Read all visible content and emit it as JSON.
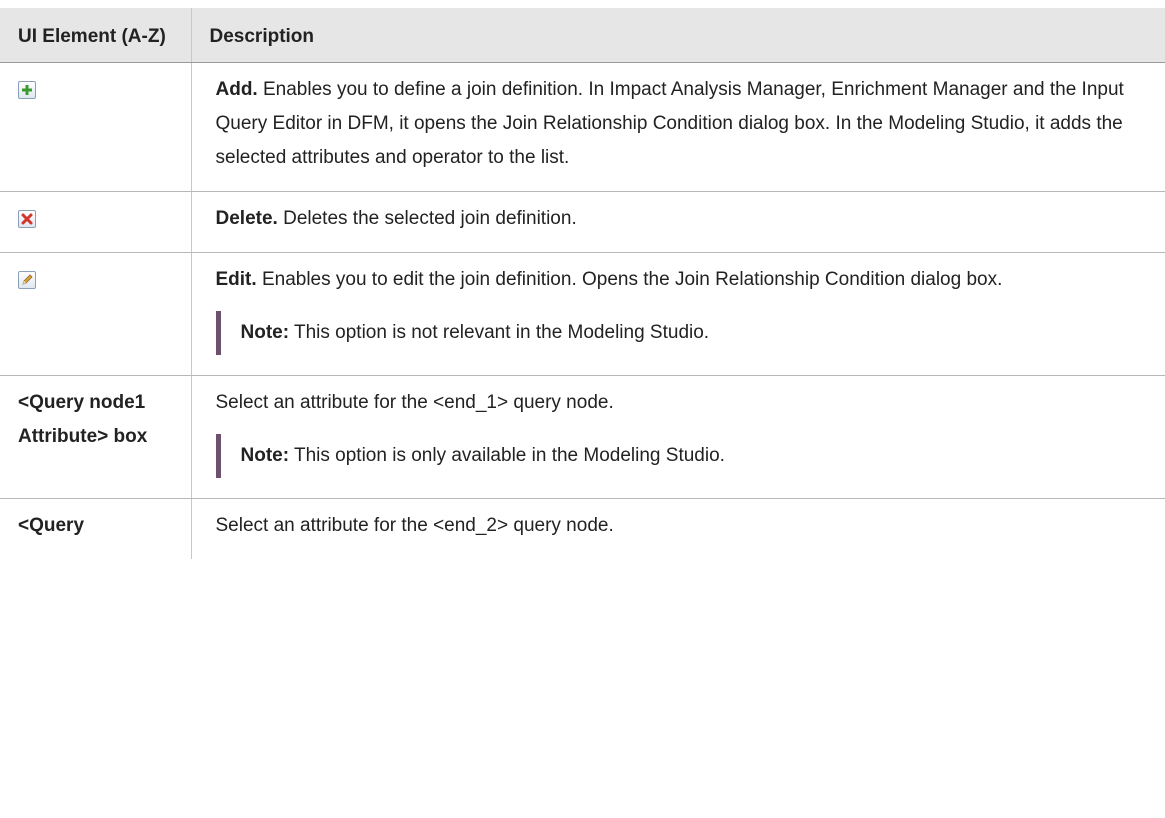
{
  "table": {
    "headers": {
      "element": "UI Element (A-Z)",
      "description": "Description"
    },
    "rows": [
      {
        "element_icon": "add-icon",
        "title": "Add.",
        "text": "Enables you to define a join definition. In Impact Analysis Manager, Enrichment Manager and the Input Query Editor in DFM, it opens the Join Relationship Condition dialog box. In the Modeling Studio, it adds the selected attributes and operator to the list."
      },
      {
        "element_icon": "delete-icon",
        "title": "Delete.",
        "text": "Deletes the selected join definition."
      },
      {
        "element_icon": "edit-icon",
        "title": "Edit.",
        "text": "Enables you to edit the join definition. Opens the Join Relationship Condition dialog box.",
        "note_label": "Note:",
        "note_text": "This option is not relevant in the Modeling Studio."
      },
      {
        "element_label": "<Query node1 Attribute> box",
        "text": "Select an attribute for the <end_1> query node.",
        "note_label": "Note:",
        "note_text": "This option is only available in the Modeling Studio."
      },
      {
        "element_label": "<Query",
        "text": "Select an attribute for the <end_2> query node."
      }
    ]
  },
  "colors": {
    "header_bg": "#e6e6e6",
    "note_bar": "#6d4f6e",
    "add_icon": "#3c9a2e",
    "delete_icon": "#d2352b",
    "edit_icon": "#e0a13a"
  }
}
